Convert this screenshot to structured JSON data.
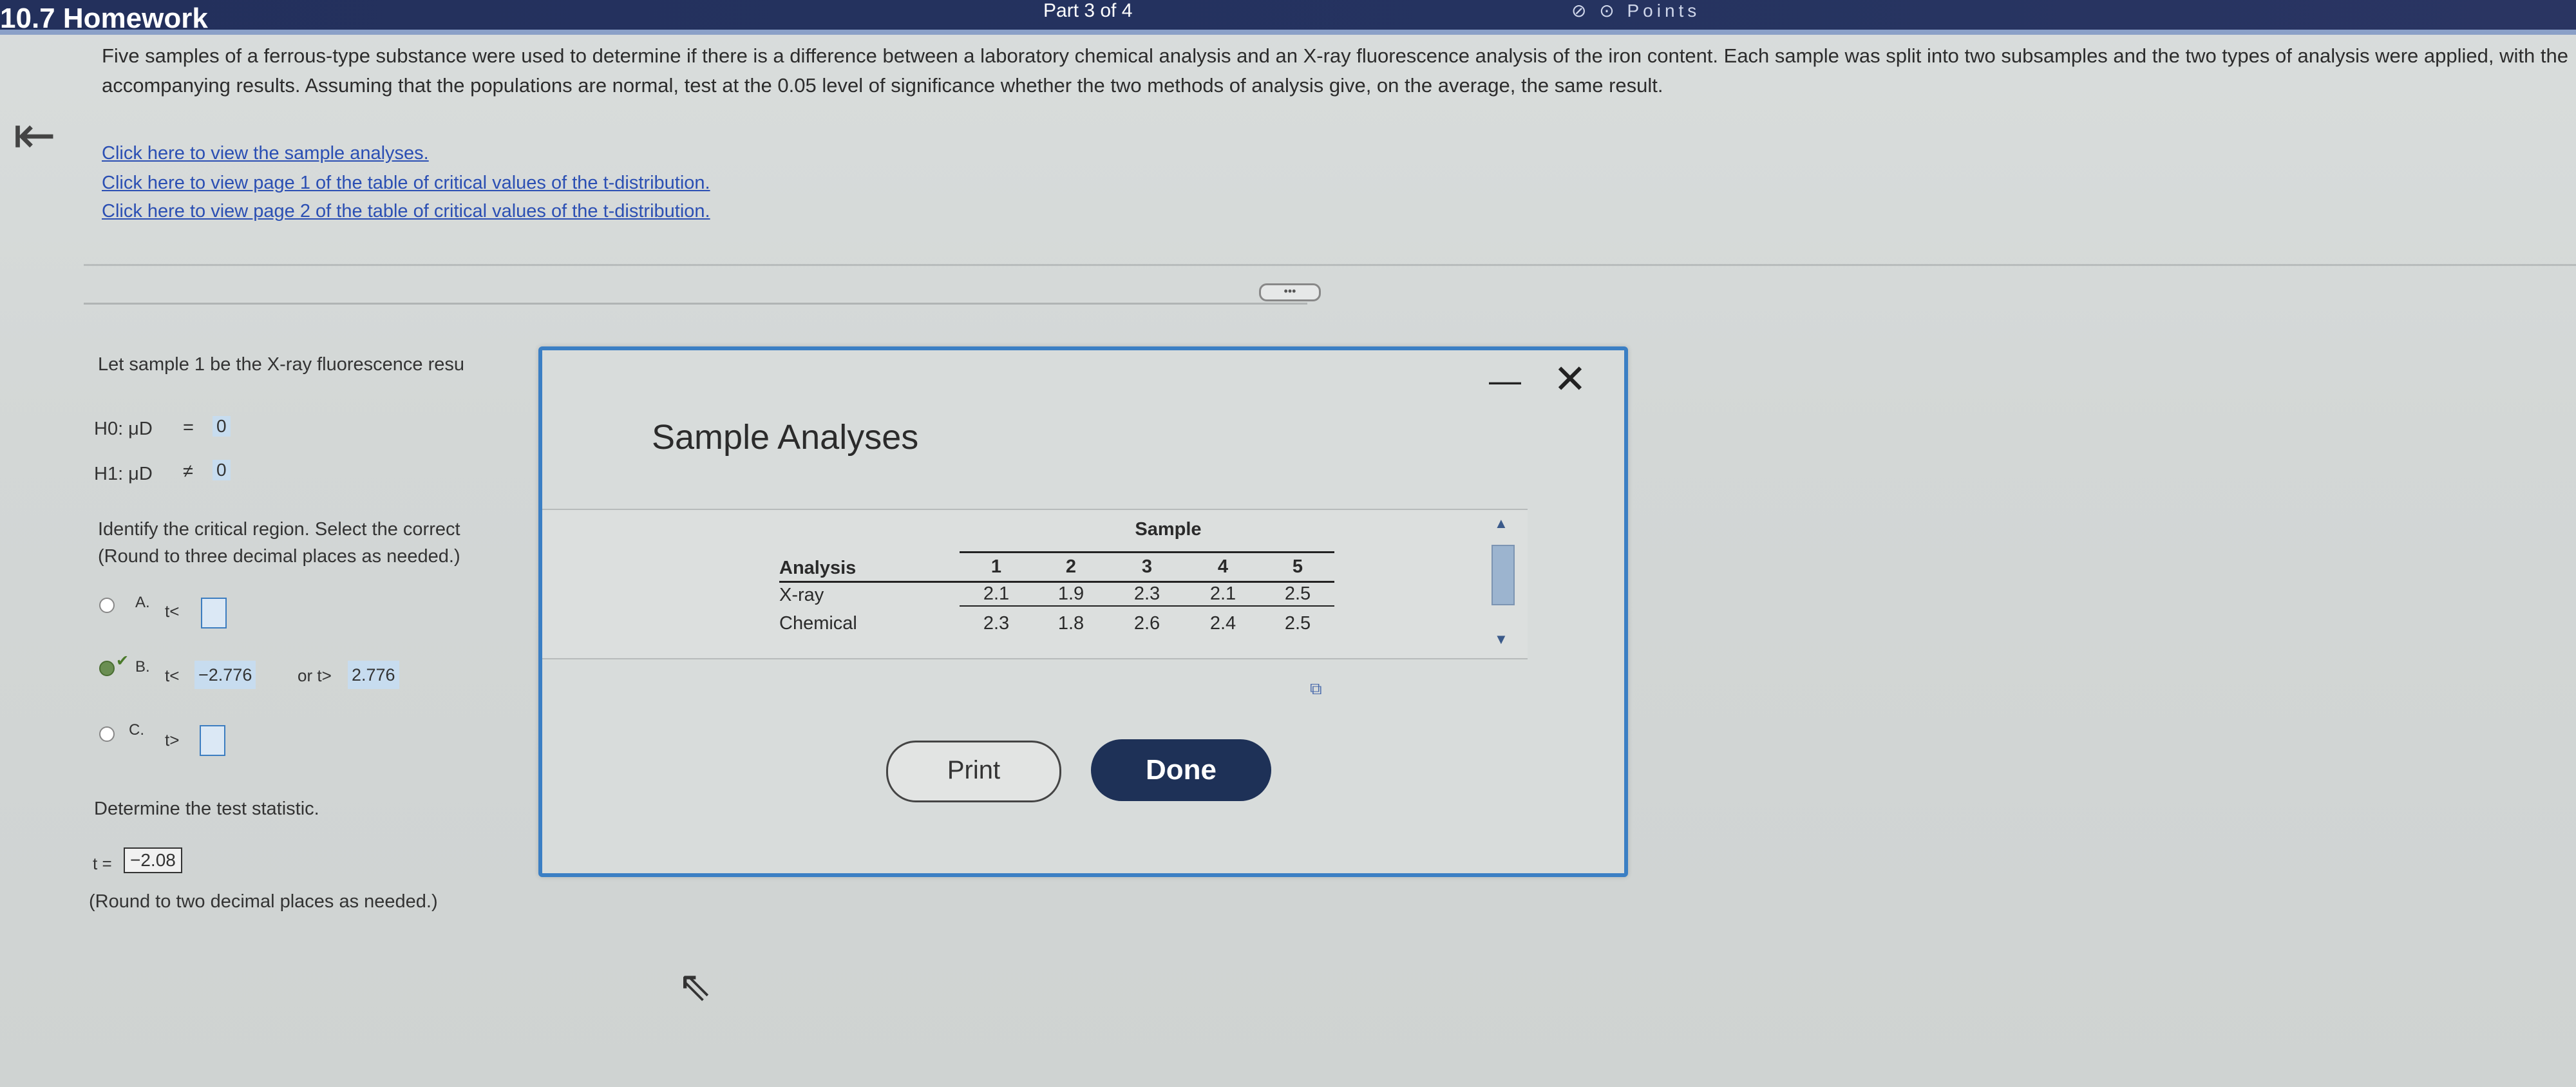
{
  "header": {
    "title": "10.7 Homework",
    "part": "Part 3 of 4",
    "right_icons": "⊘ ⊙ Points"
  },
  "problem": {
    "text": "Five samples of a ferrous-type substance were used to determine if there is a difference between a laboratory chemical analysis and an X-ray fluorescence analysis of the iron content. Each sample was split into two subsamples and the two types of analysis were applied, with the accompanying results. Assuming that the populations are normal, test at the 0.05 level of significance whether the two methods of analysis give, on the average, the same result.",
    "links": [
      "Click here to view the sample analyses.",
      "Click here to view page 1 of the table of critical values of the t-distribution.",
      "Click here to view page 2 of the table of critical values of the t-distribution."
    ]
  },
  "question": {
    "intro": "Let sample 1 be the X-ray fluorescence resu",
    "h0_label": "H0: μD",
    "h0_op": "=",
    "h0_val": "0",
    "h1_label": "H1: μD",
    "h1_op": "≠",
    "h1_val": "0",
    "critical_prompt": "Identify the critical region. Select the correct",
    "critical_round": "(Round to three decimal places as needed.)",
    "options": [
      {
        "letter": "A.",
        "text": "t<",
        "value": ""
      },
      {
        "letter": "B.",
        "text_left": "t<",
        "value_left": "−2.776",
        "text_mid": "or t>",
        "value_right": "2.776"
      },
      {
        "letter": "C.",
        "text": "t>",
        "value": ""
      }
    ],
    "stat_prompt": "Determine the test statistic.",
    "stat_label": "t =",
    "stat_value": "−2.08",
    "stat_round": "(Round to two decimal places as needed.)"
  },
  "dialog": {
    "title": "Sample Analyses",
    "minimize": "—",
    "close": "✕",
    "table": {
      "sample_header": "Sample",
      "analysis_header": "Analysis",
      "columns": [
        "1",
        "2",
        "3",
        "4",
        "5"
      ],
      "rows": [
        {
          "label": "X-ray",
          "values": [
            "2.1",
            "1.9",
            "2.3",
            "2.1",
            "2.5"
          ]
        },
        {
          "label": "Chemical",
          "values": [
            "2.3",
            "1.8",
            "2.6",
            "2.4",
            "2.5"
          ]
        }
      ]
    },
    "print_label": "Print",
    "done_label": "Done"
  },
  "more_button": "•••"
}
